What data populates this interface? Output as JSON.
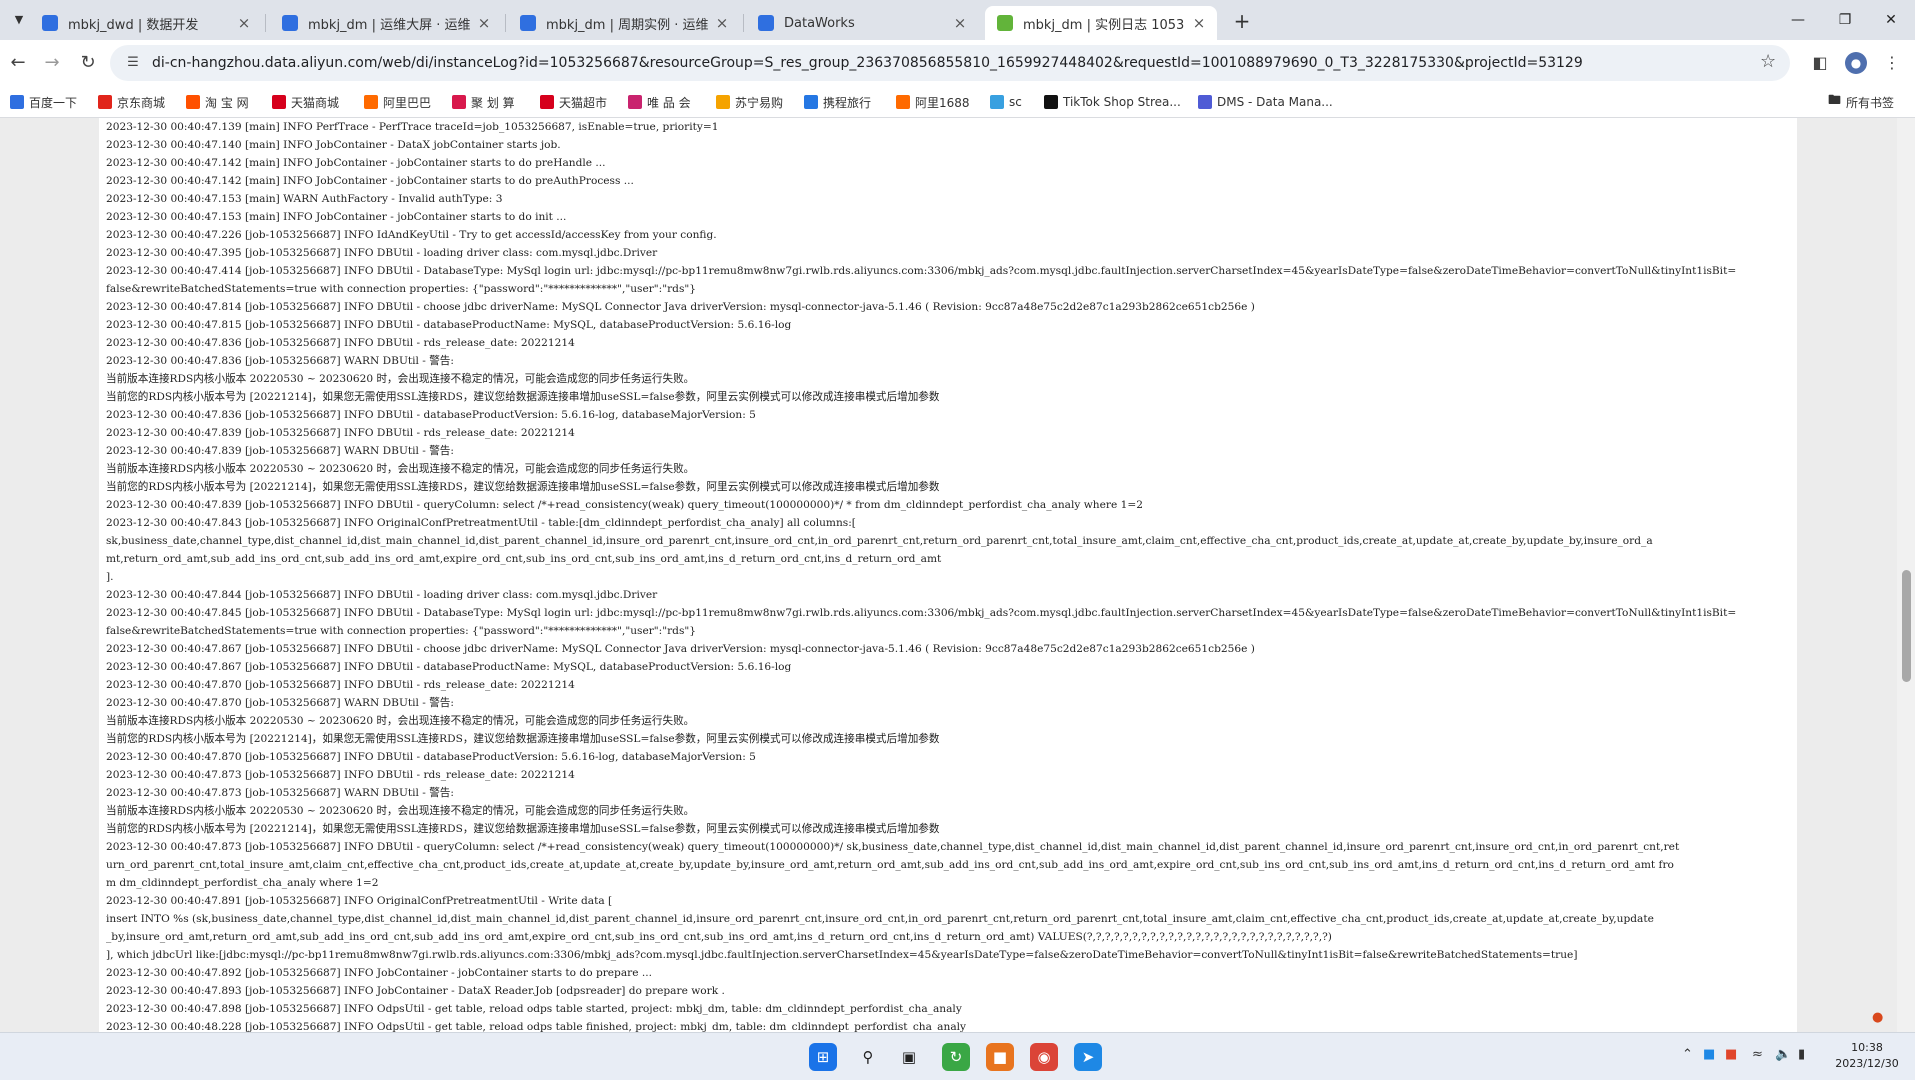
{
  "browser": {
    "tabs": [
      {
        "label": "mbkj_dwd | 数据开发",
        "color": "#2f6fe0"
      },
      {
        "label": "mbkj_dm | 运维大屏 · 运维中心",
        "color": "#2f6fe0"
      },
      {
        "label": "mbkj_dm | 周期实例 · 运维中心",
        "color": "#2f6fe0"
      },
      {
        "label": "DataWorks",
        "color": "#2f6fe0"
      },
      {
        "label": "mbkj_dm | 实例日志 1053256687",
        "color": "#62b43a"
      }
    ],
    "active_tab": 4,
    "url": "di-cn-hangzhou.data.aliyun.com/web/di/instanceLog?id=1053256687&resourceGroup=S_res_group_236370856855810_1659927448402&requestId=1001088979690_0_T3_3228175330&projectId=53129",
    "bookmarks": [
      {
        "label": "百度一下",
        "icon": "paw-icon",
        "color": "#2f6fe0"
      },
      {
        "label": "京东商城",
        "icon": "jd-icon",
        "color": "#e1251b"
      },
      {
        "label": "淘 宝 网",
        "icon": "taobao-icon",
        "color": "#ff5000"
      },
      {
        "label": "天猫商城",
        "icon": "tmall-icon",
        "color": "#d6001c"
      },
      {
        "label": "阿里巴巴",
        "icon": "alibaba-icon",
        "color": "#ff6a00"
      },
      {
        "label": "聚 划 算",
        "icon": "juhuasuan-icon",
        "color": "#d8194c"
      },
      {
        "label": "天猫超市",
        "icon": "tmall-market-icon",
        "color": "#d6001c"
      },
      {
        "label": "唯 品 会",
        "icon": "vip-icon",
        "color": "#c9236e"
      },
      {
        "label": "苏宁易购",
        "icon": "suning-icon",
        "color": "#f5a300"
      },
      {
        "label": "携程旅行",
        "icon": "ctrip-icon",
        "color": "#2577e3"
      },
      {
        "label": "阿里1688",
        "icon": "1688-icon",
        "color": "#ff6a00"
      },
      {
        "label": "sc",
        "icon": "sc-icon",
        "color": "#38a0e0"
      },
      {
        "label": "TikTok Shop Strea...",
        "icon": "tiktok-icon",
        "color": "#111111"
      },
      {
        "label": "DMS - Data Mana...",
        "icon": "dms-icon",
        "color": "#4f5bd5"
      }
    ],
    "all_bookmarks_label": "所有书签"
  },
  "log_lines": [
    "2023-12-30 00:40:47.139 [main] INFO  PerfTrace - PerfTrace traceId=job_1053256687, isEnable=true, priority=1",
    "2023-12-30 00:40:47.140 [main] INFO  JobContainer - DataX jobContainer starts job.",
    "2023-12-30 00:40:47.142 [main] INFO  JobContainer - jobContainer starts to do preHandle ...",
    "2023-12-30 00:40:47.142 [main] INFO  JobContainer - jobContainer starts to do preAuthProcess ...",
    "2023-12-30 00:40:47.153 [main] WARN  AuthFactory - Invalid authType: 3",
    "2023-12-30 00:40:47.153 [main] INFO  JobContainer - jobContainer starts to do init ...",
    "2023-12-30 00:40:47.226 [job-1053256687] INFO  IdAndKeyUtil - Try to get accessId/accessKey from your config.",
    "2023-12-30 00:40:47.395 [job-1053256687] INFO  DBUtil - loading driver class: com.mysql.jdbc.Driver",
    "2023-12-30 00:40:47.414 [job-1053256687] INFO  DBUtil - DatabaseType: MySql login url: jdbc:mysql://pc-bp11remu8mw8nw7gi.rwlb.rds.aliyuncs.com:3306/mbkj_ads?com.mysql.jdbc.faultInjection.serverCharsetIndex=45&yearIsDateType=false&zeroDateTimeBehavior=convertToNull&tinyInt1isBit=",
    "false&rewriteBatchedStatements=true with connection properties: {\"password\":\"*************\",\"user\":\"rds\"}",
    "2023-12-30 00:40:47.814 [job-1053256687] INFO  DBUtil - choose jdbc driverName: MySQL Connector Java driverVersion: mysql-connector-java-5.1.46 ( Revision: 9cc87a48e75c2d2e87c1a293b2862ce651cb256e )",
    "2023-12-30 00:40:47.815 [job-1053256687] INFO  DBUtil - databaseProductName: MySQL, databaseProductVersion: 5.6.16-log",
    "2023-12-30 00:40:47.836 [job-1053256687] INFO  DBUtil - rds_release_date: 20221214",
    "2023-12-30 00:40:47.836 [job-1053256687] WARN  DBUtil - 警告:",
    "当前版本连接RDS内核小版本 20220530 ~ 20230620 时，会出现连接不稳定的情况，可能会造成您的同步任务运行失败。",
    "当前您的RDS内核小版本号为 [20221214]，如果您无需使用SSL连接RDS，建议您给数据源连接串增加useSSL=false参数，阿里云实例模式可以修改成连接串模式后增加参数",
    "2023-12-30 00:40:47.836 [job-1053256687] INFO  DBUtil - databaseProductVersion: 5.6.16-log, databaseMajorVersion: 5",
    "2023-12-30 00:40:47.839 [job-1053256687] INFO  DBUtil - rds_release_date: 20221214",
    "2023-12-30 00:40:47.839 [job-1053256687] WARN  DBUtil - 警告:",
    "当前版本连接RDS内核小版本 20220530 ~ 20230620 时，会出现连接不稳定的情况，可能会造成您的同步任务运行失败。",
    "当前您的RDS内核小版本号为 [20221214]，如果您无需使用SSL连接RDS，建议您给数据源连接串增加useSSL=false参数，阿里云实例模式可以修改成连接串模式后增加参数",
    "2023-12-30 00:40:47.839 [job-1053256687] INFO  DBUtil - queryColumn: select /*+read_consistency(weak) query_timeout(100000000)*/ * from dm_cldinndept_perfordist_cha_analy where 1=2",
    "2023-12-30 00:40:47.843 [job-1053256687] INFO  OriginalConfPretreatmentUtil - table:[dm_cldinndept_perfordist_cha_analy] all columns:[",
    "sk,business_date,channel_type,dist_channel_id,dist_main_channel_id,dist_parent_channel_id,insure_ord_parenrt_cnt,insure_ord_cnt,in_ord_parenrt_cnt,return_ord_parenrt_cnt,total_insure_amt,claim_cnt,effective_cha_cnt,product_ids,create_at,update_at,create_by,update_by,insure_ord_a",
    "mt,return_ord_amt,sub_add_ins_ord_cnt,sub_add_ins_ord_amt,expire_ord_cnt,sub_ins_ord_cnt,sub_ins_ord_amt,ins_d_return_ord_cnt,ins_d_return_ord_amt",
    "].",
    "2023-12-30 00:40:47.844 [job-1053256687] INFO  DBUtil - loading driver class: com.mysql.jdbc.Driver",
    "2023-12-30 00:40:47.845 [job-1053256687] INFO  DBUtil - DatabaseType: MySql login url: jdbc:mysql://pc-bp11remu8mw8nw7gi.rwlb.rds.aliyuncs.com:3306/mbkj_ads?com.mysql.jdbc.faultInjection.serverCharsetIndex=45&yearIsDateType=false&zeroDateTimeBehavior=convertToNull&tinyInt1isBit=",
    "false&rewriteBatchedStatements=true with connection properties: {\"password\":\"*************\",\"user\":\"rds\"}",
    "2023-12-30 00:40:47.867 [job-1053256687] INFO  DBUtil - choose jdbc driverName: MySQL Connector Java driverVersion: mysql-connector-java-5.1.46 ( Revision: 9cc87a48e75c2d2e87c1a293b2862ce651cb256e )",
    "2023-12-30 00:40:47.867 [job-1053256687] INFO  DBUtil - databaseProductName: MySQL, databaseProductVersion: 5.6.16-log",
    "2023-12-30 00:40:47.870 [job-1053256687] INFO  DBUtil - rds_release_date: 20221214",
    "2023-12-30 00:40:47.870 [job-1053256687] WARN  DBUtil - 警告:",
    "当前版本连接RDS内核小版本 20220530 ~ 20230620 时，会出现连接不稳定的情况，可能会造成您的同步任务运行失败。",
    "当前您的RDS内核小版本号为 [20221214]，如果您无需使用SSL连接RDS，建议您给数据源连接串增加useSSL=false参数，阿里云实例模式可以修改成连接串模式后增加参数",
    "2023-12-30 00:40:47.870 [job-1053256687] INFO  DBUtil - databaseProductVersion: 5.6.16-log, databaseMajorVersion: 5",
    "2023-12-30 00:40:47.873 [job-1053256687] INFO  DBUtil - rds_release_date: 20221214",
    "2023-12-30 00:40:47.873 [job-1053256687] WARN  DBUtil - 警告:",
    "当前版本连接RDS内核小版本 20220530 ~ 20230620 时，会出现连接不稳定的情况，可能会造成您的同步任务运行失败。",
    "当前您的RDS内核小版本号为 [20221214]，如果您无需使用SSL连接RDS，建议您给数据源连接串增加useSSL=false参数，阿里云实例模式可以修改成连接串模式后增加参数",
    "2023-12-30 00:40:47.873 [job-1053256687] INFO  DBUtil - queryColumn: select /*+read_consistency(weak) query_timeout(100000000)*/ sk,business_date,channel_type,dist_channel_id,dist_main_channel_id,dist_parent_channel_id,insure_ord_parenrt_cnt,insure_ord_cnt,in_ord_parenrt_cnt,ret",
    "urn_ord_parenrt_cnt,total_insure_amt,claim_cnt,effective_cha_cnt,product_ids,create_at,update_at,create_by,update_by,insure_ord_amt,return_ord_amt,sub_add_ins_ord_cnt,sub_add_ins_ord_amt,expire_ord_cnt,sub_ins_ord_cnt,sub_ins_ord_amt,ins_d_return_ord_cnt,ins_d_return_ord_amt fro",
    "m dm_cldinndept_perfordist_cha_analy where 1=2",
    "2023-12-30 00:40:47.891 [job-1053256687] INFO  OriginalConfPretreatmentUtil - Write data [",
    "insert INTO %s (sk,business_date,channel_type,dist_channel_id,dist_main_channel_id,dist_parent_channel_id,insure_ord_parenrt_cnt,insure_ord_cnt,in_ord_parenrt_cnt,return_ord_parenrt_cnt,total_insure_amt,claim_cnt,effective_cha_cnt,product_ids,create_at,update_at,create_by,update",
    "_by,insure_ord_amt,return_ord_amt,sub_add_ins_ord_cnt,sub_add_ins_ord_amt,expire_ord_cnt,sub_ins_ord_cnt,sub_ins_ord_amt,ins_d_return_ord_cnt,ins_d_return_ord_amt) VALUES(?,?,?,?,?,?,?,?,?,?,?,?,?,?,?,?,?,?,?,?,?,?,?,?,?,?,?)",
    "], which jdbcUrl like:[jdbc:mysql://pc-bp11remu8mw8nw7gi.rwlb.rds.aliyuncs.com:3306/mbkj_ads?com.mysql.jdbc.faultInjection.serverCharsetIndex=45&yearIsDateType=false&zeroDateTimeBehavior=convertToNull&tinyInt1isBit=false&rewriteBatchedStatements=true]",
    "2023-12-30 00:40:47.892 [job-1053256687] INFO  JobContainer - jobContainer starts to do prepare ...",
    "2023-12-30 00:40:47.893 [job-1053256687] INFO  JobContainer - DataX Reader.Job [odpsreader] do prepare work .",
    "2023-12-30 00:40:47.898 [job-1053256687] INFO  OdpsUtil - get table, reload odps table started, project: mbkj_dm,  table: dm_cldinndept_perfordist_cha_analy",
    "2023-12-30 00:40:48.228 [job-1053256687] INFO  OdpsUtil - get table, reload odps table finished, project: mbkj_dm,  table: dm_cldinndept_perfordist_cha_analy"
  ],
  "taskbar": {
    "time": "10:38",
    "date": "2023/12/30"
  }
}
